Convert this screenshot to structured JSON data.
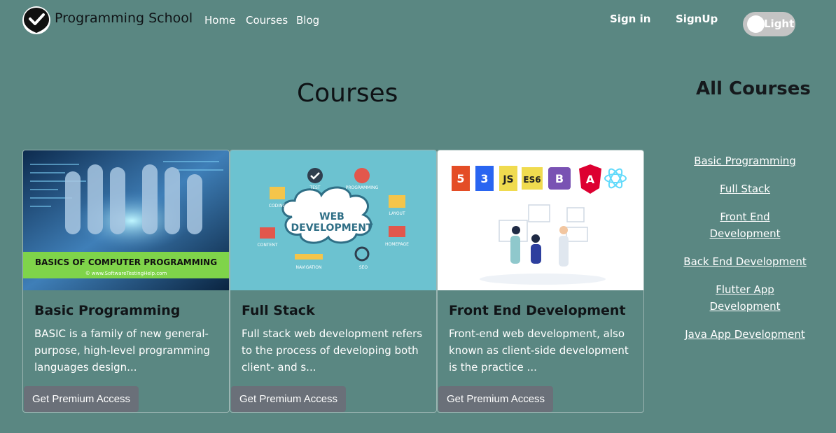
{
  "nav": {
    "brand": "Programming School",
    "links": [
      "Home",
      "Courses",
      "Blog"
    ],
    "signin": "Sign in",
    "signup": "SignUp",
    "theme_toggle": "Light"
  },
  "main": {
    "title": "Courses",
    "cards": [
      {
        "title": "Basic Programming",
        "text": "BASIC is a family of new general-purpose, high-level programming languages design...",
        "button": "Get Premium Access",
        "image_caption": "BASICS OF COMPUTER PROGRAMMING",
        "image_subcaption": "© www.SoftwareTestingHelp.com"
      },
      {
        "title": "Full Stack",
        "text": "Full stack web development refers to the process of developing both client- and s...",
        "button": "Get Premium Access",
        "image_center": "WEB DEVELOPMENT",
        "image_labels": [
          "TEST",
          "PROGRAMMING",
          "CODING",
          "LAYOUT",
          "CONTENT",
          "HOMEPAGE",
          "NAVIGATION",
          "SEO"
        ]
      },
      {
        "title": "Front End Development",
        "text": "Front-end web development, also known as client-side development is the practice ...",
        "button": "Get Premium Access",
        "badges": [
          "5",
          "3",
          "JS",
          "ES6",
          "B",
          "A"
        ]
      }
    ]
  },
  "sidebar": {
    "title": "All Courses",
    "links": [
      "Basic Programming",
      "Full Stack",
      "Front End Development",
      "Back End Development",
      "Flutter App Development",
      "Java App Development"
    ]
  },
  "colors": {
    "background": "#5a8782",
    "button": "#6a7079",
    "toggle": "#c4c4c4"
  }
}
